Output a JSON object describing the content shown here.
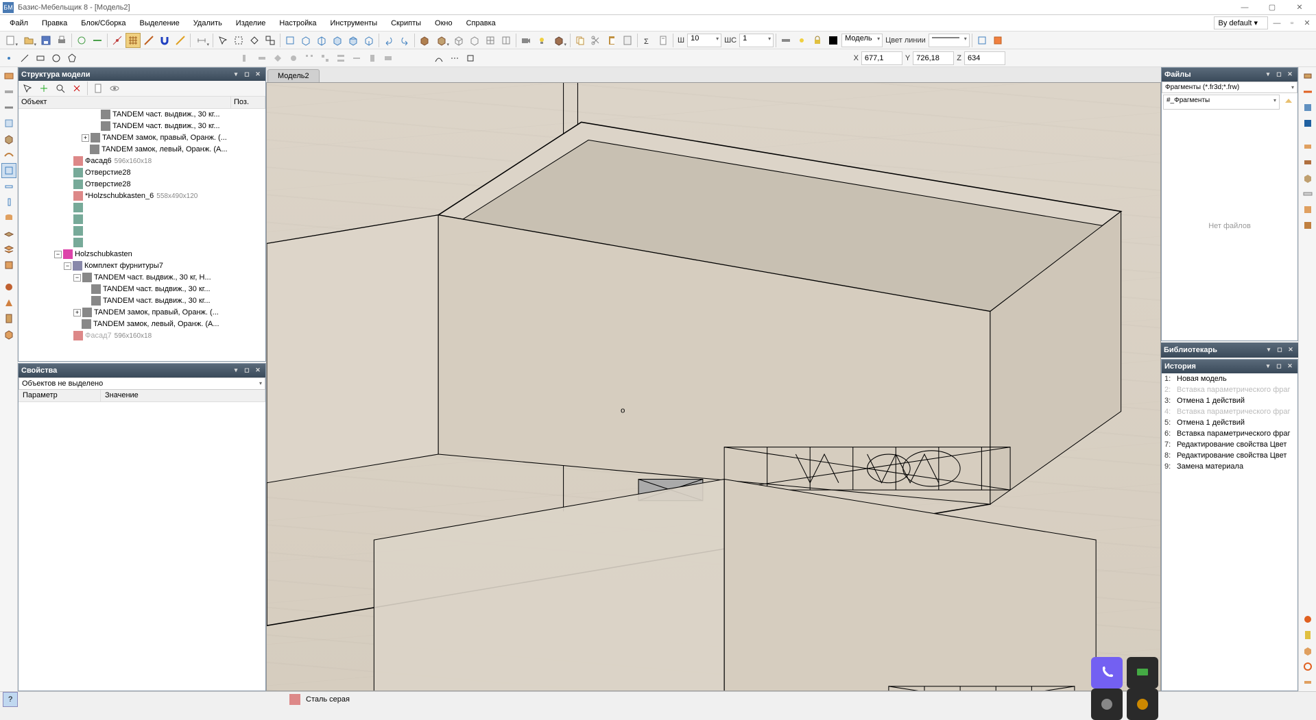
{
  "app": {
    "title": "Базис-Мебельщик 8 - [Модель2]",
    "icon_abbr": "БМ"
  },
  "menu": {
    "items": [
      "Файл",
      "Правка",
      "Блок/Сборка",
      "Выделение",
      "Удалить",
      "Изделие",
      "Настройка",
      "Инструменты",
      "Скрипты",
      "Окно",
      "Справка"
    ],
    "default_label": "By default"
  },
  "toolbar2": {
    "sh_label": "Ш",
    "sh_value": "10",
    "shs_label": "ШС",
    "shs_value": "1",
    "modes_label": "Модель",
    "line_color_label": "Цвет линии"
  },
  "coords": {
    "x_label": "X",
    "x": "677,1",
    "y_label": "Y",
    "y": "726,18",
    "z_label": "Z",
    "z": "634"
  },
  "viewport": {
    "tab": "Модель2",
    "center_mark": "o"
  },
  "tree_panel": {
    "title": "Структура модели",
    "col_object": "Объект",
    "col_pos": "Поз.",
    "items": [
      {
        "indent": 120,
        "icon": "icon-cube",
        "label": "TANDEM част. выдвиж., 30 кг...",
        "gray": false
      },
      {
        "indent": 120,
        "icon": "icon-cube",
        "label": "TANDEM част. выдвиж., 30 кг...",
        "gray": false
      },
      {
        "indent": 92,
        "toggle": "+",
        "icon": "icon-cube",
        "label": "TANDEM замок, правый, Оранж. (...",
        "gray": false
      },
      {
        "indent": 104,
        "icon": "icon-cube",
        "label": "TANDEM замок, левый, Оранж. (A...",
        "gray": false
      },
      {
        "indent": 80,
        "icon": "icon-panel",
        "label": "Фасад6",
        "dim": "596x160x18",
        "gray": false
      },
      {
        "indent": 80,
        "icon": "icon-hole",
        "label": "Отверстие28",
        "gray": false
      },
      {
        "indent": 80,
        "icon": "icon-hole",
        "label": "Отверстие28",
        "gray": false
      },
      {
        "indent": 80,
        "icon": "icon-panel",
        "label": "*Holzschubkasten_6",
        "dim": "558x490x120",
        "gray": false
      },
      {
        "indent": 80,
        "icon": "icon-hole",
        "label": "",
        "gray": false
      },
      {
        "indent": 80,
        "icon": "icon-hole",
        "label": "",
        "gray": false
      },
      {
        "indent": 80,
        "icon": "icon-hole",
        "label": "",
        "gray": false
      },
      {
        "indent": 80,
        "icon": "icon-hole",
        "label": "",
        "gray": false
      },
      {
        "indent": 52,
        "toggle": "−",
        "icon": "icon-asm",
        "label": "Holzschubkasten",
        "gray": false
      },
      {
        "indent": 66,
        "toggle": "−",
        "icon": "icon-group",
        "label": "Комплект фурнитуры7",
        "gray": false
      },
      {
        "indent": 80,
        "toggle": "−",
        "icon": "icon-cube",
        "label": "TANDEM част. выдвиж., 30 кг, Н...",
        "gray": false
      },
      {
        "indent": 106,
        "icon": "icon-cube",
        "label": "TANDEM част. выдвиж., 30 кг...",
        "gray": false
      },
      {
        "indent": 106,
        "icon": "icon-cube",
        "label": "TANDEM част. выдвиж., 30 кг...",
        "gray": false
      },
      {
        "indent": 80,
        "toggle": "+",
        "icon": "icon-cube",
        "label": "TANDEM замок, правый, Оранж. (...",
        "gray": false
      },
      {
        "indent": 92,
        "icon": "icon-cube",
        "label": "TANDEM замок, левый, Оранж. (A...",
        "gray": false
      },
      {
        "indent": 80,
        "icon": "icon-panel",
        "label": "Фасад7",
        "dim": "596x160x18",
        "gray": true
      }
    ]
  },
  "props_panel": {
    "title": "Свойства",
    "selector": "Объектов не выделено",
    "col_param": "Параметр",
    "col_value": "Значение"
  },
  "files_panel": {
    "title": "Файлы",
    "filter": "Фрагменты (*.fr3d;*.frw)",
    "folder": "#_Фрагменты",
    "empty_text": "Нет файлов"
  },
  "librarian": {
    "title": "Библиотекарь"
  },
  "history": {
    "title": "История",
    "items": [
      {
        "n": "1:",
        "t": "Новая модель",
        "gray": false
      },
      {
        "n": "2:",
        "t": "Вставка параметрического фраг",
        "gray": true
      },
      {
        "n": "3:",
        "t": "Отмена 1 действий",
        "gray": false
      },
      {
        "n": "4:",
        "t": "Вставка параметрического фраг",
        "gray": true
      },
      {
        "n": "5:",
        "t": "Отмена 1 действий",
        "gray": false
      },
      {
        "n": "6:",
        "t": "Вставка параметрического фраг",
        "gray": false
      },
      {
        "n": "7:",
        "t": "Редактирование свойства Цвет",
        "gray": false
      },
      {
        "n": "8:",
        "t": "Редактирование свойства Цвет",
        "gray": false
      },
      {
        "n": "9:",
        "t": "Замена материала",
        "gray": false
      }
    ]
  },
  "statusbar": {
    "help": "?",
    "material": "Сталь серая"
  }
}
